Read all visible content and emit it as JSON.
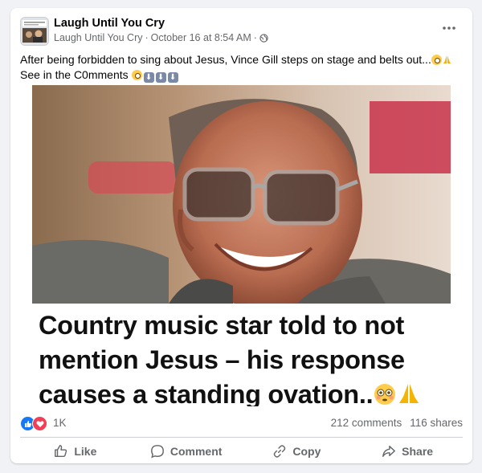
{
  "post": {
    "page_name": "Laugh Until You Cry",
    "author": "Laugh Until You Cry",
    "separator": " · ",
    "timestamp": "October 16 at 8:54 AM",
    "caption_text": "After being forbidden to sing about Jesus, Vince Gill steps on stage and belts out...",
    "caption_see": " See in the C0mments ",
    "image_text": "Country music star told to not mention Jesus – his response causes a standing ovation.."
  },
  "stats": {
    "reactions": "1K",
    "comments": "212 comments",
    "shares": "116 shares"
  },
  "actions": {
    "like": "Like",
    "comment": "Comment",
    "copy": "Copy",
    "share": "Share"
  },
  "colors": {
    "accent": "#1877f2",
    "love": "#f33e58",
    "muted": "#65676b"
  }
}
